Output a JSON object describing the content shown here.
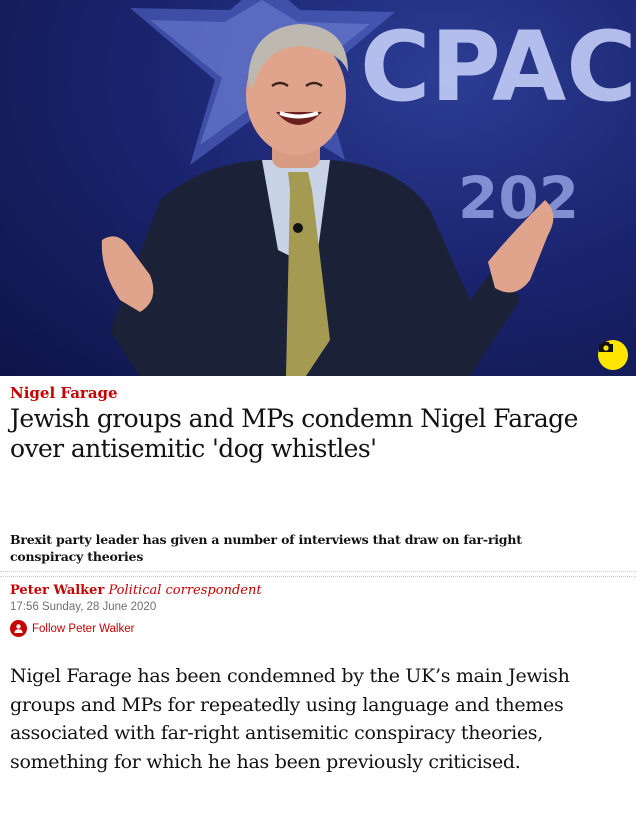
{
  "hero": {
    "backdrop_text": "CPAC",
    "backdrop_year": "202",
    "camera_icon": "camera-icon"
  },
  "article": {
    "kicker": "Nigel Farage",
    "headline": "Jewish groups and MPs condemn Nigel Farage over antisemitic 'dog whistles'",
    "standfirst": "Brexit party leader has given a number of interviews that draw on far-right conspiracy theories",
    "byline_name": "Peter Walker",
    "byline_role": "Political correspondent",
    "dateline": "17:56 Sunday, 28 June 2020",
    "follow_label": "Follow Peter Walker",
    "follow_icon": "person-add-icon",
    "body": "Nigel Farage has been condemned by the UK’s main Jewish groups and MPs for repeatedly using language and themes associated with far-right antisemitic conspiracy theories, something for which he has been previously criticised."
  },
  "colors": {
    "accent": "#c70000",
    "camera_button": "#ffe500",
    "hero_background": "#1b2570"
  }
}
